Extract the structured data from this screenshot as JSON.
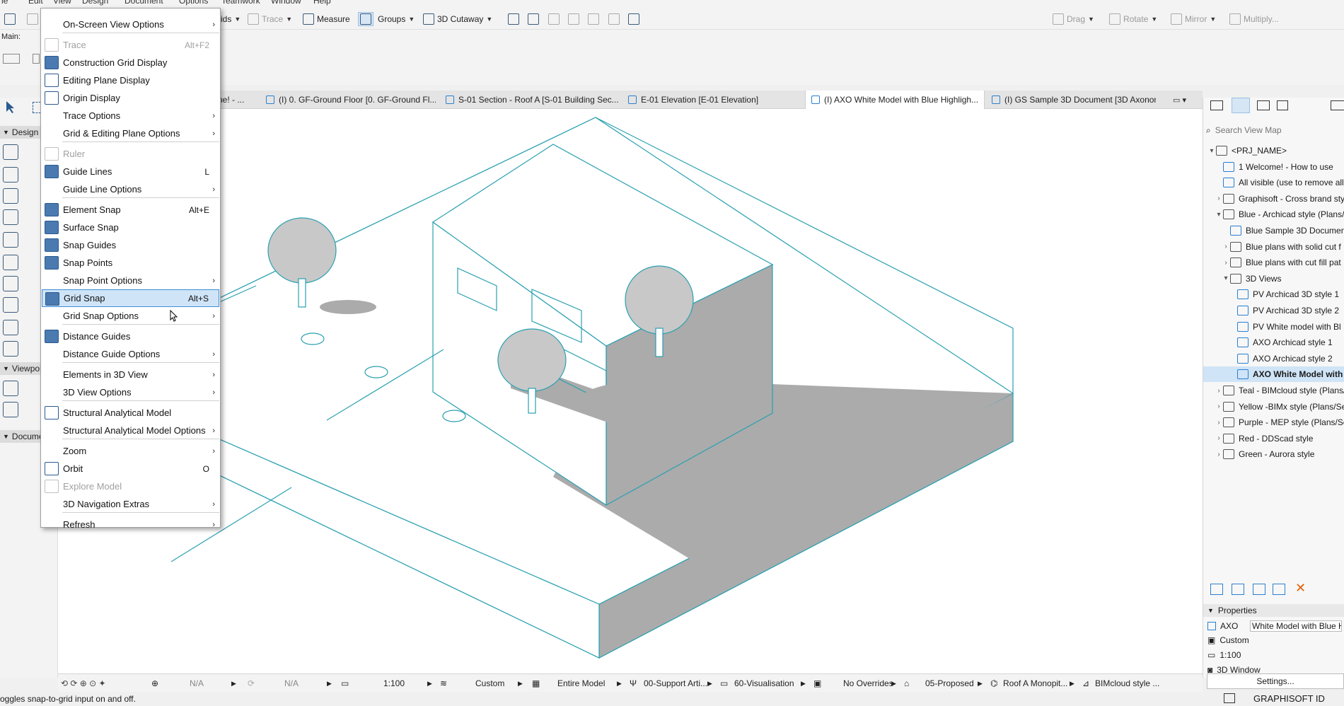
{
  "menubar": [
    "le",
    "Edit",
    "View",
    "Design",
    "Document",
    "Options",
    "Teamwork",
    "Window",
    "Help"
  ],
  "toolbar": {
    "ids_label": "ids",
    "trace_label": "Trace",
    "measure_label": "Measure",
    "groups_label": "Groups",
    "cutaway_label": "3D Cutaway",
    "drag_label": "Drag",
    "rotate_label": "Rotate",
    "mirror_label": "Mirror",
    "multiply_label": "Multiply..."
  },
  "infobox": {
    "main_label": "Main:"
  },
  "tabs": [
    {
      "label": "ne! - ..."
    },
    {
      "label": "(I) 0. GF-Ground Floor [0. GF-Ground Fl..."
    },
    {
      "label": "S-01 Section - Roof A [S-01 Building Sec..."
    },
    {
      "label": "E-01 Elevation [E-01 Elevation]"
    },
    {
      "label": "(I) AXO White Model with Blue Highligh...",
      "close": "×"
    },
    {
      "label": "(I) GS Sample 3D Document [3D Axonom..."
    }
  ],
  "left_panel": {
    "design": "Design",
    "viewpoint": "Viewpoi",
    "document": "Docume"
  },
  "menu": {
    "items": [
      {
        "label": "On-Screen View Options",
        "shortcut": "",
        "submenu": true,
        "disabled": false,
        "icon": "none"
      },
      {
        "label": "Trace",
        "shortcut": "Alt+F2",
        "submenu": false,
        "disabled": true,
        "icon": "trace-icon"
      },
      {
        "label": "Construction Grid Display",
        "shortcut": "",
        "submenu": false,
        "disabled": false,
        "icon": "construction-grid-icon",
        "checked": true
      },
      {
        "label": "Editing Plane Display",
        "shortcut": "",
        "submenu": false,
        "disabled": false,
        "icon": "editing-plane-icon"
      },
      {
        "label": "Origin Display",
        "shortcut": "",
        "submenu": false,
        "disabled": false,
        "icon": "origin-icon"
      },
      {
        "label": "Trace Options",
        "shortcut": "",
        "submenu": true,
        "disabled": false,
        "icon": "none"
      },
      {
        "label": "Grid & Editing Plane Options",
        "shortcut": "",
        "submenu": true,
        "disabled": false,
        "icon": "none"
      },
      {
        "label": "Ruler",
        "shortcut": "",
        "submenu": false,
        "disabled": true,
        "icon": "ruler-icon"
      },
      {
        "label": "Guide Lines",
        "shortcut": "L",
        "submenu": false,
        "disabled": false,
        "icon": "guide-lines-icon",
        "checked": true
      },
      {
        "label": "Guide Line Options",
        "shortcut": "",
        "submenu": true,
        "disabled": false,
        "icon": "none"
      },
      {
        "label": "Element Snap",
        "shortcut": "Alt+E",
        "submenu": false,
        "disabled": false,
        "icon": "element-snap-icon",
        "checked": true
      },
      {
        "label": "Surface Snap",
        "shortcut": "",
        "submenu": false,
        "disabled": false,
        "icon": "surface-snap-icon",
        "checked": true
      },
      {
        "label": "Snap Guides",
        "shortcut": "",
        "submenu": false,
        "disabled": false,
        "icon": "snap-guides-icon",
        "checked": true
      },
      {
        "label": "Snap Points",
        "shortcut": "",
        "submenu": false,
        "disabled": false,
        "icon": "snap-points-icon",
        "checked": true
      },
      {
        "label": "Snap Point Options",
        "shortcut": "",
        "submenu": true,
        "disabled": false,
        "icon": "none"
      },
      {
        "label": "Grid Snap",
        "shortcut": "Alt+S",
        "submenu": false,
        "disabled": false,
        "icon": "grid-snap-icon",
        "highlighted": true
      },
      {
        "label": "Grid Snap Options",
        "shortcut": "",
        "submenu": true,
        "disabled": false,
        "icon": "none"
      },
      {
        "label": "Distance Guides",
        "shortcut": "",
        "submenu": false,
        "disabled": false,
        "icon": "distance-guides-icon",
        "checked": true
      },
      {
        "label": "Distance Guide Options",
        "shortcut": "",
        "submenu": true,
        "disabled": false,
        "icon": "none"
      },
      {
        "label": "Elements in 3D View",
        "shortcut": "",
        "submenu": true,
        "disabled": false,
        "icon": "none"
      },
      {
        "label": "3D View Options",
        "shortcut": "",
        "submenu": true,
        "disabled": false,
        "icon": "none"
      },
      {
        "label": "Structural Analytical Model",
        "shortcut": "",
        "submenu": false,
        "disabled": false,
        "icon": "structural-model-icon"
      },
      {
        "label": "Structural Analytical Model Options",
        "shortcut": "",
        "submenu": true,
        "disabled": false,
        "icon": "none"
      },
      {
        "label": "Zoom",
        "shortcut": "",
        "submenu": true,
        "disabled": false,
        "icon": "none"
      },
      {
        "label": "Orbit",
        "shortcut": "O",
        "submenu": false,
        "disabled": false,
        "icon": "orbit-icon"
      },
      {
        "label": "Explore Model",
        "shortcut": "",
        "submenu": false,
        "disabled": true,
        "icon": "explore-icon"
      },
      {
        "label": "3D Navigation Extras",
        "shortcut": "",
        "submenu": true,
        "disabled": false,
        "icon": "none"
      },
      {
        "label": "Refresh",
        "shortcut": "",
        "submenu": true,
        "disabled": false,
        "icon": "none"
      }
    ]
  },
  "navigator": {
    "search_placeholder": "Search View Map",
    "rows": [
      {
        "label": "<PRJ_NAME>",
        "level": 0,
        "exp": "▾",
        "type": "project"
      },
      {
        "label": "1 Welcome! - How to use",
        "level": 1,
        "exp": "",
        "type": "view"
      },
      {
        "label": "All visible (use to remove all",
        "level": 1,
        "exp": "",
        "type": "view"
      },
      {
        "label": "Graphisoft - Cross brand sty",
        "level": 1,
        "exp": "›",
        "type": "folder"
      },
      {
        "label": "Blue - Archicad style (Plans/S",
        "level": 1,
        "exp": "▾",
        "type": "folder"
      },
      {
        "label": "Blue Sample 3D Document",
        "level": 2,
        "exp": "",
        "type": "view"
      },
      {
        "label": "Blue plans with solid cut f",
        "level": 2,
        "exp": "›",
        "type": "folder"
      },
      {
        "label": "Blue plans with cut fill pat",
        "level": 2,
        "exp": "›",
        "type": "folder"
      },
      {
        "label": "3D Views",
        "level": 2,
        "exp": "▾",
        "type": "folder"
      },
      {
        "label": "PV Archicad 3D style 1",
        "level": 3,
        "exp": "",
        "type": "view"
      },
      {
        "label": "PV Archicad 3D style 2",
        "level": 3,
        "exp": "",
        "type": "view"
      },
      {
        "label": "PV White model with Bl",
        "level": 3,
        "exp": "",
        "type": "view"
      },
      {
        "label": "AXO Archicad style 1",
        "level": 3,
        "exp": "",
        "type": "view"
      },
      {
        "label": "AXO Archicad style 2",
        "level": 3,
        "exp": "",
        "type": "view"
      },
      {
        "label": "AXO White Model with",
        "level": 3,
        "exp": "",
        "type": "view",
        "selected": true
      },
      {
        "label": "Teal - BIMcloud style (Plans/",
        "level": 1,
        "exp": "›",
        "type": "folder"
      },
      {
        "label": "Yellow -BIMx style (Plans/Se",
        "level": 1,
        "exp": "›",
        "type": "folder"
      },
      {
        "label": "Purple - MEP style (Plans/Sec",
        "level": 1,
        "exp": "›",
        "type": "folder"
      },
      {
        "label": "Red - DDScad style",
        "level": 1,
        "exp": "›",
        "type": "folder"
      },
      {
        "label": "Green - Aurora style",
        "level": 1,
        "exp": "›",
        "type": "folder"
      }
    ]
  },
  "properties": {
    "title": "Properties",
    "id": "AXO",
    "name": "White Model with Blue H",
    "custom": "Custom",
    "scale": "1:100",
    "window": "3D Window",
    "settings_button": "Settings..."
  },
  "statusbar": {
    "na1": "N/A",
    "na2": "N/A",
    "scale": "1:100",
    "pen": "Custom",
    "model": "Entire Model",
    "layer": "00-Support Arti...",
    "vis": "60-Visualisation",
    "overrides": "No Overrides",
    "phase": "05-Proposed",
    "roof": "Roof A Monopit...",
    "style": "BIMcloud style ..."
  },
  "hint_text": "oggles snap-to-grid input on and off.",
  "brand": "GRAPHISOFT ID",
  "colors": {
    "accent": "#2b7fd0",
    "model_line": "#2aa0b0",
    "shadow": "#ababab",
    "menu_highlight": "#cfe4f7"
  }
}
